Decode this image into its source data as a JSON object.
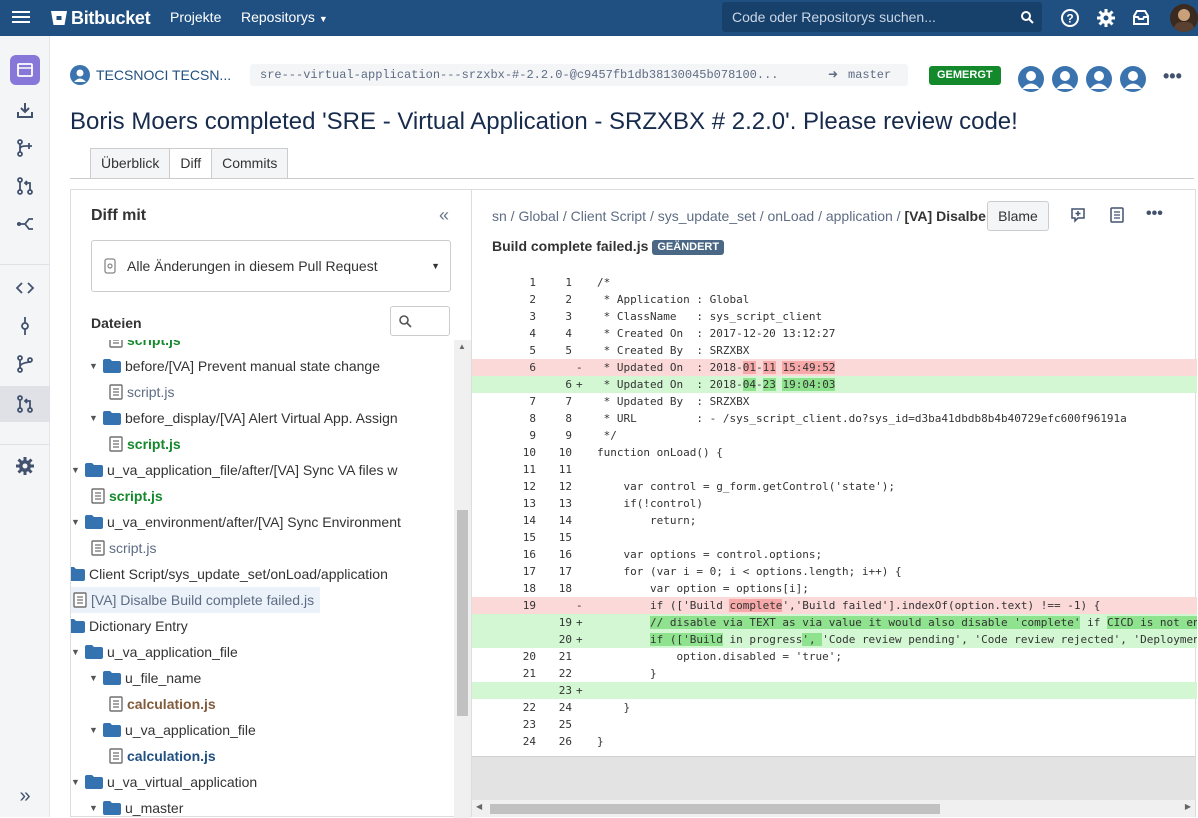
{
  "topbar": {
    "logo": "Bitbucket",
    "nav_projekte": "Projekte",
    "nav_repositorys": "Repositorys",
    "search_placeholder": "Code oder Repositorys suchen..."
  },
  "header": {
    "project": "TECSNOCI TECSN...",
    "branch_source": "sre---virtual-application---srzxbx-#-2.2.0-@c9457fb1db38130045b078100...",
    "branch_target": "master",
    "status": "GEMERGT",
    "title": "Boris Moers completed 'SRE - Virtual Application - SRZXBX # 2.2.0'. Please review code!"
  },
  "tabs": [
    "Überblick",
    "Diff",
    "Commits"
  ],
  "left": {
    "heading": "Diff mit",
    "dropdown": "Alle Änderungen in diesem Pull Request",
    "files_label": "Dateien",
    "tree": [
      {
        "label": "script.js",
        "type": "file",
        "style": "green",
        "indent": 5
      },
      {
        "label": "before/[VA] Prevent manual state change",
        "type": "folder",
        "indent": 4
      },
      {
        "label": "script.js",
        "type": "file",
        "style": "plain",
        "indent": 5
      },
      {
        "label": "before_display/[VA] Alert Virtual App. Assign",
        "type": "folder",
        "indent": 4
      },
      {
        "label": "script.js",
        "type": "file",
        "style": "green",
        "indent": 5
      },
      {
        "label": "u_va_application_file/after/[VA] Sync VA files w",
        "type": "folder",
        "indent": 3
      },
      {
        "label": "script.js",
        "type": "file",
        "style": "green",
        "indent": 4
      },
      {
        "label": "u_va_environment/after/[VA] Sync Environment",
        "type": "folder",
        "indent": 3
      },
      {
        "label": "script.js",
        "type": "file",
        "style": "plain",
        "indent": 4
      },
      {
        "label": "Client Script/sys_update_set/onLoad/application",
        "type": "folder",
        "indent": 2
      },
      {
        "label": "[VA] Disalbe Build complete failed.js",
        "type": "file",
        "style": "selected",
        "indent": 3
      },
      {
        "label": "Dictionary Entry",
        "type": "folder",
        "indent": 2
      },
      {
        "label": "u_va_application_file",
        "type": "folder",
        "indent": 3
      },
      {
        "label": "u_file_name",
        "type": "folder",
        "indent": 4
      },
      {
        "label": "calculation.js",
        "type": "file",
        "style": "brown",
        "indent": 5
      },
      {
        "label": "u_va_application_file",
        "type": "folder",
        "indent": 4
      },
      {
        "label": "calculation.js",
        "type": "file",
        "style": "blue",
        "indent": 5
      },
      {
        "label": "u_va_virtual_application",
        "type": "folder",
        "indent": 3
      },
      {
        "label": "u_master",
        "type": "folder",
        "indent": 4
      }
    ]
  },
  "right": {
    "breadcrumb": "sn / Global / Client Script / sys_update_set / onLoad / application / ",
    "breadcrumb_bold": "[VA] Disalbe",
    "filename": "Build complete failed.js",
    "filestatus": "GEÄNDERT",
    "blame": "Blame",
    "lines": [
      {
        "a": "1",
        "b": "1",
        "m": "",
        "t": "/*",
        "k": "ctx"
      },
      {
        "a": "2",
        "b": "2",
        "m": "",
        "t": " * Application : Global",
        "k": "ctx"
      },
      {
        "a": "3",
        "b": "3",
        "m": "",
        "t": " * ClassName   : sys_script_client",
        "k": "ctx"
      },
      {
        "a": "4",
        "b": "4",
        "m": "",
        "t": " * Created On  : 2017-12-20 13:12:27",
        "k": "ctx"
      },
      {
        "a": "5",
        "b": "5",
        "m": "",
        "t": " * Created By  : SRZXBX",
        "k": "ctx"
      },
      {
        "a": "6",
        "b": "",
        "m": "-",
        "t": " * Updated On  : 2018-<r>01</r>-<r>11</r> <r>15:49:52</r>",
        "k": "del"
      },
      {
        "a": "",
        "b": "6",
        "m": "+",
        "t": " * Updated On  : 2018-<g>04</g>-<g>23</g> <g>19:04:03</g>",
        "k": "add"
      },
      {
        "a": "7",
        "b": "7",
        "m": "",
        "t": " * Updated By  : SRZXBX",
        "k": "ctx"
      },
      {
        "a": "8",
        "b": "8",
        "m": "",
        "t": " * URL         : - /sys_script_client.do?sys_id=d3ba41dbdb8b4b40729efc600f96191a",
        "k": "ctx"
      },
      {
        "a": "9",
        "b": "9",
        "m": "",
        "t": " */",
        "k": "ctx"
      },
      {
        "a": "10",
        "b": "10",
        "m": "",
        "t": "function onLoad() {",
        "k": "ctx"
      },
      {
        "a": "11",
        "b": "11",
        "m": "",
        "t": "",
        "k": "ctx"
      },
      {
        "a": "12",
        "b": "12",
        "m": "",
        "t": "    var control = g_form.getControl('state');",
        "k": "ctx"
      },
      {
        "a": "13",
        "b": "13",
        "m": "",
        "t": "    if(!control)",
        "k": "ctx"
      },
      {
        "a": "14",
        "b": "14",
        "m": "",
        "t": "        return;",
        "k": "ctx"
      },
      {
        "a": "15",
        "b": "15",
        "m": "",
        "t": "",
        "k": "ctx"
      },
      {
        "a": "16",
        "b": "16",
        "m": "",
        "t": "    var options = control.options;",
        "k": "ctx"
      },
      {
        "a": "17",
        "b": "17",
        "m": "",
        "t": "    for (var i = 0; i < options.length; i++) {",
        "k": "ctx"
      },
      {
        "a": "18",
        "b": "18",
        "m": "",
        "t": "        var option = options[i];",
        "k": "ctx"
      },
      {
        "a": "19",
        "b": "",
        "m": "-",
        "t": "        if (['Build <r>complete</r>','Build failed'].indexOf(option.text) !== -1) {",
        "k": "del"
      },
      {
        "a": "",
        "b": "19",
        "m": "+",
        "t": "        <g>// disable via TEXT as via value it would also disable 'complete'</g> if <g>CICD is not en</g>",
        "k": "add"
      },
      {
        "a": "",
        "b": "20",
        "m": "+",
        "t": "        <g>if (['Build</g> in progress<g>', </g>'Code review pending', 'Code review rejected', 'Deploymen",
        "k": "add"
      },
      {
        "a": "20",
        "b": "21",
        "m": "",
        "t": "            option.disabled = 'true';",
        "k": "ctx"
      },
      {
        "a": "21",
        "b": "22",
        "m": "",
        "t": "        }",
        "k": "ctx"
      },
      {
        "a": "",
        "b": "23",
        "m": "+",
        "t": "",
        "k": "add"
      },
      {
        "a": "22",
        "b": "24",
        "m": "",
        "t": "    }",
        "k": "ctx"
      },
      {
        "a": "23",
        "b": "25",
        "m": "",
        "t": "",
        "k": "ctx"
      },
      {
        "a": "24",
        "b": "26",
        "m": "",
        "t": "}",
        "k": "ctx"
      }
    ]
  },
  "icons": {
    "sidebar": [
      "repo-icon",
      "clone-icon",
      "create-branch-icon",
      "create-pr-icon",
      "fork-icon",
      "source-icon",
      "commits-icon",
      "branches-icon",
      "pull-requests-icon",
      "settings-icon",
      "expand-sidebar-icon"
    ]
  },
  "colors": {
    "brand": "#205081",
    "merged": "#14892c",
    "deleted_bg": "#fcd9d9",
    "added_bg": "#d3f7d3"
  }
}
